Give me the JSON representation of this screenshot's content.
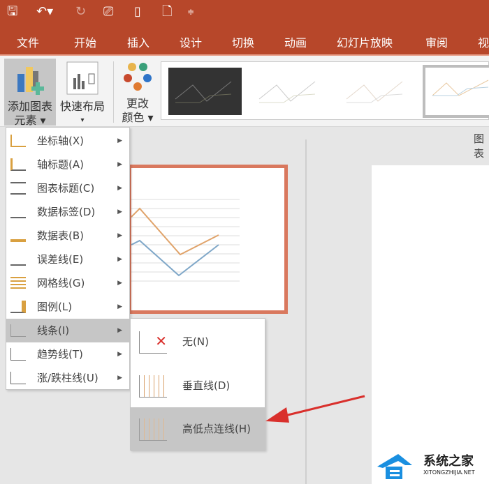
{
  "quick_access": {
    "icons": [
      "save-icon",
      "undo-icon",
      "redo-icon",
      "present-icon",
      "new-icon",
      "print-preview-icon",
      "customize-icon"
    ]
  },
  "tabs": [
    "文件",
    "开始",
    "插入",
    "设计",
    "切换",
    "动画",
    "幻灯片放映",
    "审阅",
    "视"
  ],
  "ribbon": {
    "add_element": {
      "line1": "添加图表",
      "line2": "元素 ▾"
    },
    "quick_layout": {
      "line1": "快速布局",
      "line2": "▾"
    },
    "change_color": {
      "line1": "更改",
      "line2": "颜色 ▾"
    },
    "right_label": "图表"
  },
  "menu": {
    "items": [
      {
        "label": "坐标轴(X)"
      },
      {
        "label": "轴标题(A)"
      },
      {
        "label": "图表标题(C)"
      },
      {
        "label": "数据标签(D)"
      },
      {
        "label": "数据表(B)"
      },
      {
        "label": "误差线(E)"
      },
      {
        "label": "网格线(G)"
      },
      {
        "label": "图例(L)"
      },
      {
        "label": "线条(I)",
        "highlighted": true
      },
      {
        "label": "趋势线(T)"
      },
      {
        "label": "涨/跌柱线(U)"
      }
    ]
  },
  "submenu": {
    "items": [
      {
        "label": "无(N)"
      },
      {
        "label": "垂直线(D)"
      },
      {
        "label": "高低点连线(H)",
        "highlighted": true
      }
    ]
  },
  "watermark": {
    "name": "系统之家",
    "url": "XITONGZHIJIA.NET"
  },
  "colors": {
    "brand": "#b7472a",
    "highlight": "#c6c6c6",
    "arrow": "#d9302c",
    "series1": "#e0a36a",
    "series2": "#7fa7c8"
  }
}
